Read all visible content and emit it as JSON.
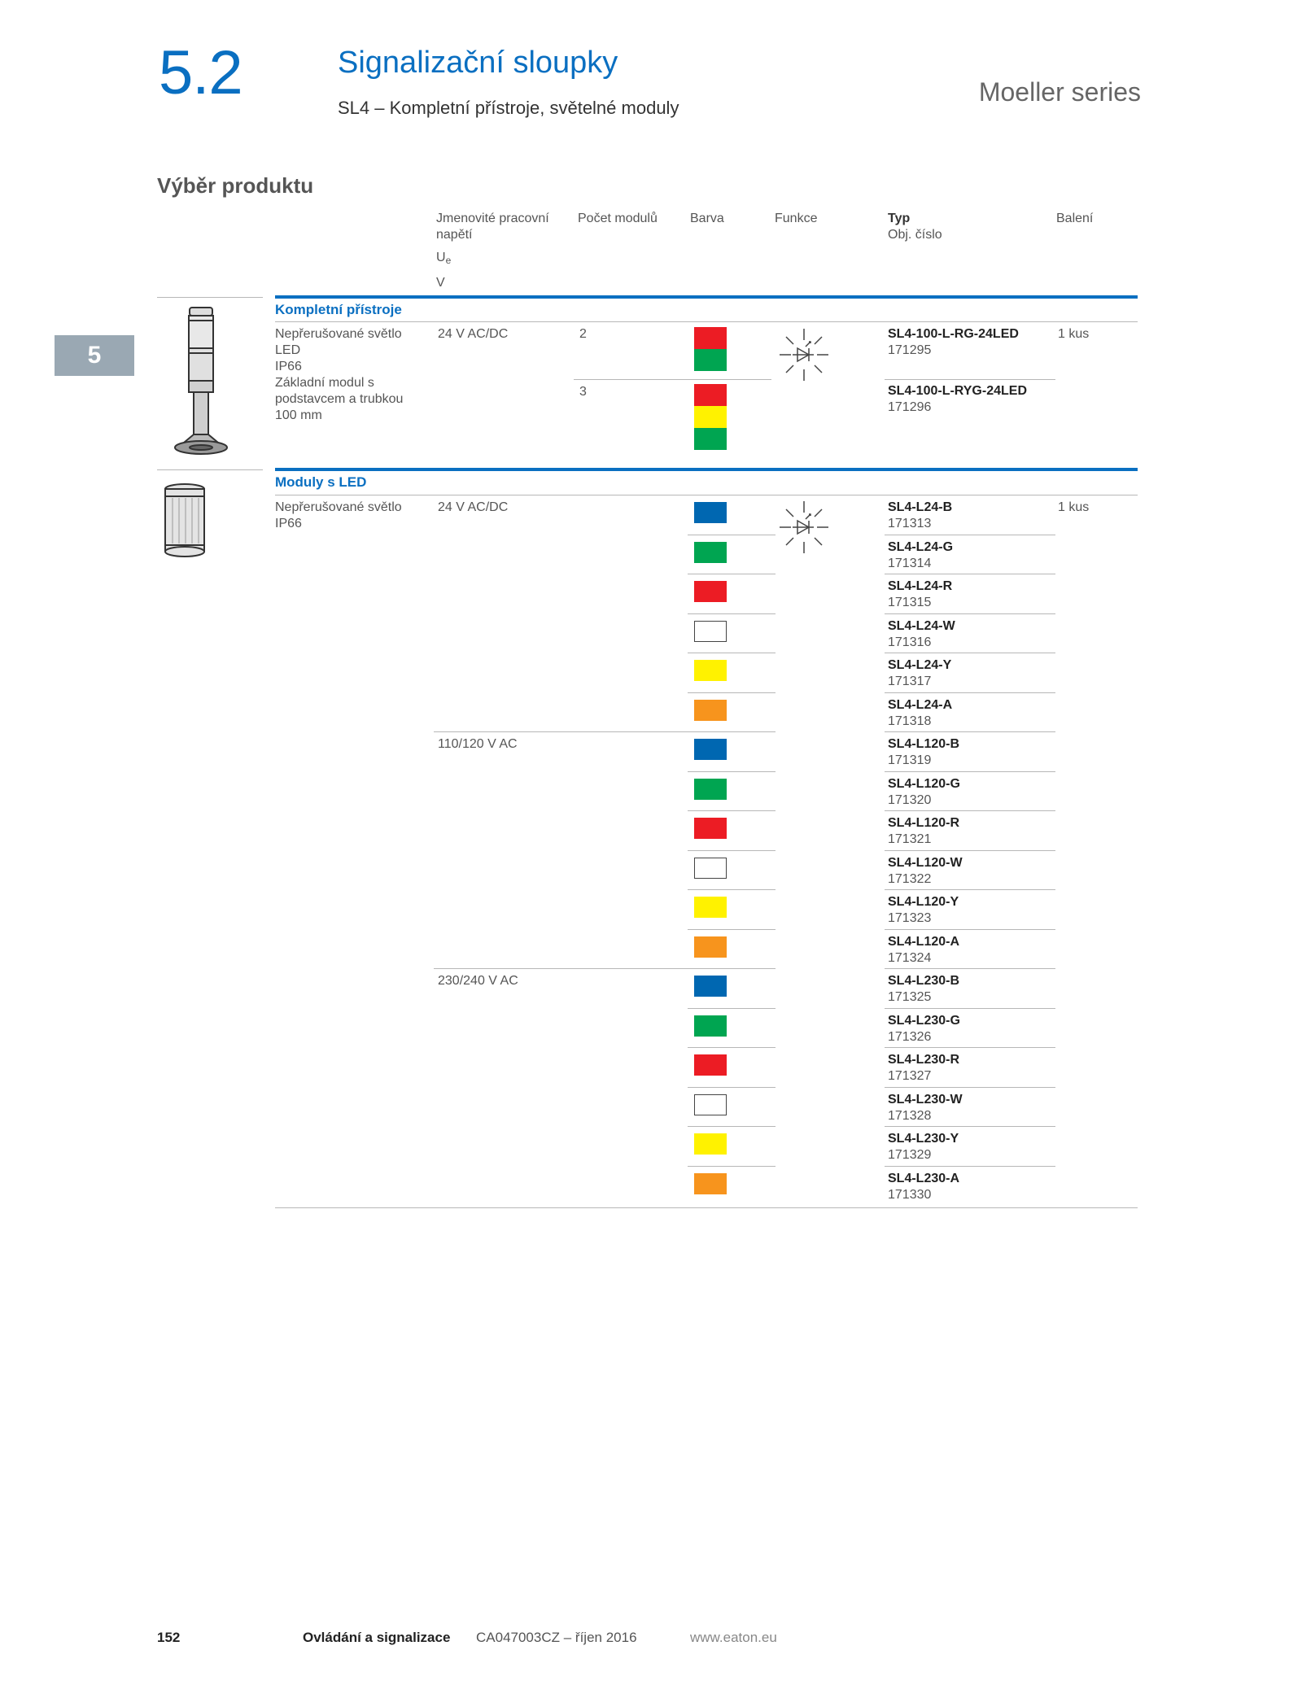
{
  "header": {
    "section_number": "5.2",
    "title": "Signalizační sloupky",
    "subtitle": "SL4 – Kompletní přístroje, světelné moduly",
    "series": "Moeller series"
  },
  "side_tab": "5",
  "section_heading": "Výběr produktu",
  "columns": {
    "voltage": "Jmenovité pracovní napětí",
    "voltage_symbol": "U",
    "voltage_symbol_sub": "e",
    "voltage_unit": "V",
    "modules": "Počet modulů",
    "color": "Barva",
    "function": "Funkce",
    "type": "Typ",
    "order_no": "Obj. číslo",
    "packaging": "Balení"
  },
  "colors": {
    "red": "#ec1c24",
    "green": "#00a551",
    "yellow": "#fff200",
    "blue": "#0067b1",
    "white": "#ffffff",
    "orange": "#f7941d",
    "accent": "#0a6fc1"
  },
  "complete": {
    "title": "Kompletní přístroje",
    "desc": [
      "Nepřerušované světlo",
      "LED",
      "IP66",
      "Základní modul s",
      "podstavcem a trubkou",
      "100 mm"
    ],
    "voltage": "24 V AC/DC",
    "packaging": "1 kus",
    "rows": [
      {
        "modules": "2",
        "type": "SL4-100-L-RG-24LED",
        "order": "171295",
        "swatches": [
          "red",
          "green"
        ]
      },
      {
        "modules": "3",
        "type": "SL4-100-L-RYG-24LED",
        "order": "171296",
        "swatches": [
          "red",
          "yellow",
          "green"
        ]
      }
    ]
  },
  "led": {
    "title": "Moduly s LED",
    "desc": [
      "Nepřerušované světlo",
      "IP66"
    ],
    "packaging": "1 kus",
    "groups": [
      {
        "voltage": "24 V AC/DC",
        "items": [
          {
            "type": "SL4-L24-B",
            "order": "171313",
            "color": "blue"
          },
          {
            "type": "SL4-L24-G",
            "order": "171314",
            "color": "green"
          },
          {
            "type": "SL4-L24-R",
            "order": "171315",
            "color": "red"
          },
          {
            "type": "SL4-L24-W",
            "order": "171316",
            "color": "white"
          },
          {
            "type": "SL4-L24-Y",
            "order": "171317",
            "color": "yellow"
          },
          {
            "type": "SL4-L24-A",
            "order": "171318",
            "color": "orange"
          }
        ]
      },
      {
        "voltage": "110/120 V AC",
        "items": [
          {
            "type": "SL4-L120-B",
            "order": "171319",
            "color": "blue"
          },
          {
            "type": "SL4-L120-G",
            "order": "171320",
            "color": "green"
          },
          {
            "type": "SL4-L120-R",
            "order": "171321",
            "color": "red"
          },
          {
            "type": "SL4-L120-W",
            "order": "171322",
            "color": "white"
          },
          {
            "type": "SL4-L120-Y",
            "order": "171323",
            "color": "yellow"
          },
          {
            "type": "SL4-L120-A",
            "order": "171324",
            "color": "orange"
          }
        ]
      },
      {
        "voltage": "230/240 V AC",
        "items": [
          {
            "type": "SL4-L230-B",
            "order": "171325",
            "color": "blue"
          },
          {
            "type": "SL4-L230-G",
            "order": "171326",
            "color": "green"
          },
          {
            "type": "SL4-L230-R",
            "order": "171327",
            "color": "red"
          },
          {
            "type": "SL4-L230-W",
            "order": "171328",
            "color": "white"
          },
          {
            "type": "SL4-L230-Y",
            "order": "171329",
            "color": "yellow"
          },
          {
            "type": "SL4-L230-A",
            "order": "171330",
            "color": "orange"
          }
        ]
      }
    ]
  },
  "footer": {
    "page": "152",
    "title": "Ovládání a signalizace",
    "catalog": "CA047003CZ – říjen 2016",
    "web": "www.eaton.eu"
  }
}
